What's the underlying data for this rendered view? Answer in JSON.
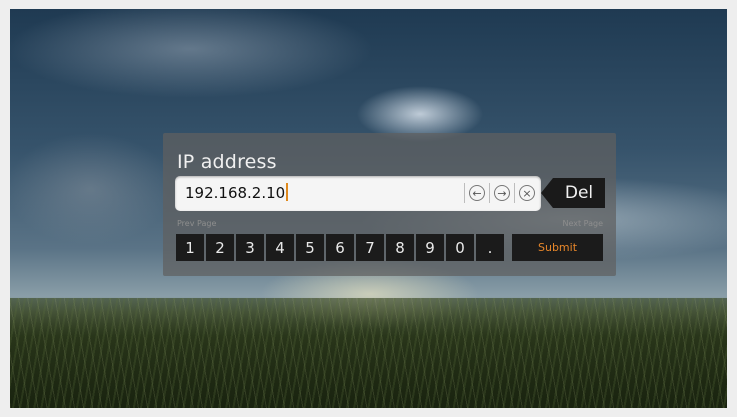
{
  "dialog": {
    "title": "IP address",
    "input_value": "192.168.2.10",
    "del_label": "Del",
    "prev_page_label": "Prev Page",
    "next_page_label": "Next Page",
    "keys": [
      "1",
      "2",
      "3",
      "4",
      "5",
      "6",
      "7",
      "8",
      "9",
      "0",
      "."
    ],
    "submit_label": "Submit",
    "icons": {
      "move_left": "arrow-left-circle-icon",
      "move_right": "arrow-right-circle-icon",
      "clear": "clear-x-circle-icon"
    }
  },
  "colors": {
    "accent": "#e6862a",
    "key_bg": "#1b1b1b",
    "dialog_bg": "#5f5f5f"
  }
}
